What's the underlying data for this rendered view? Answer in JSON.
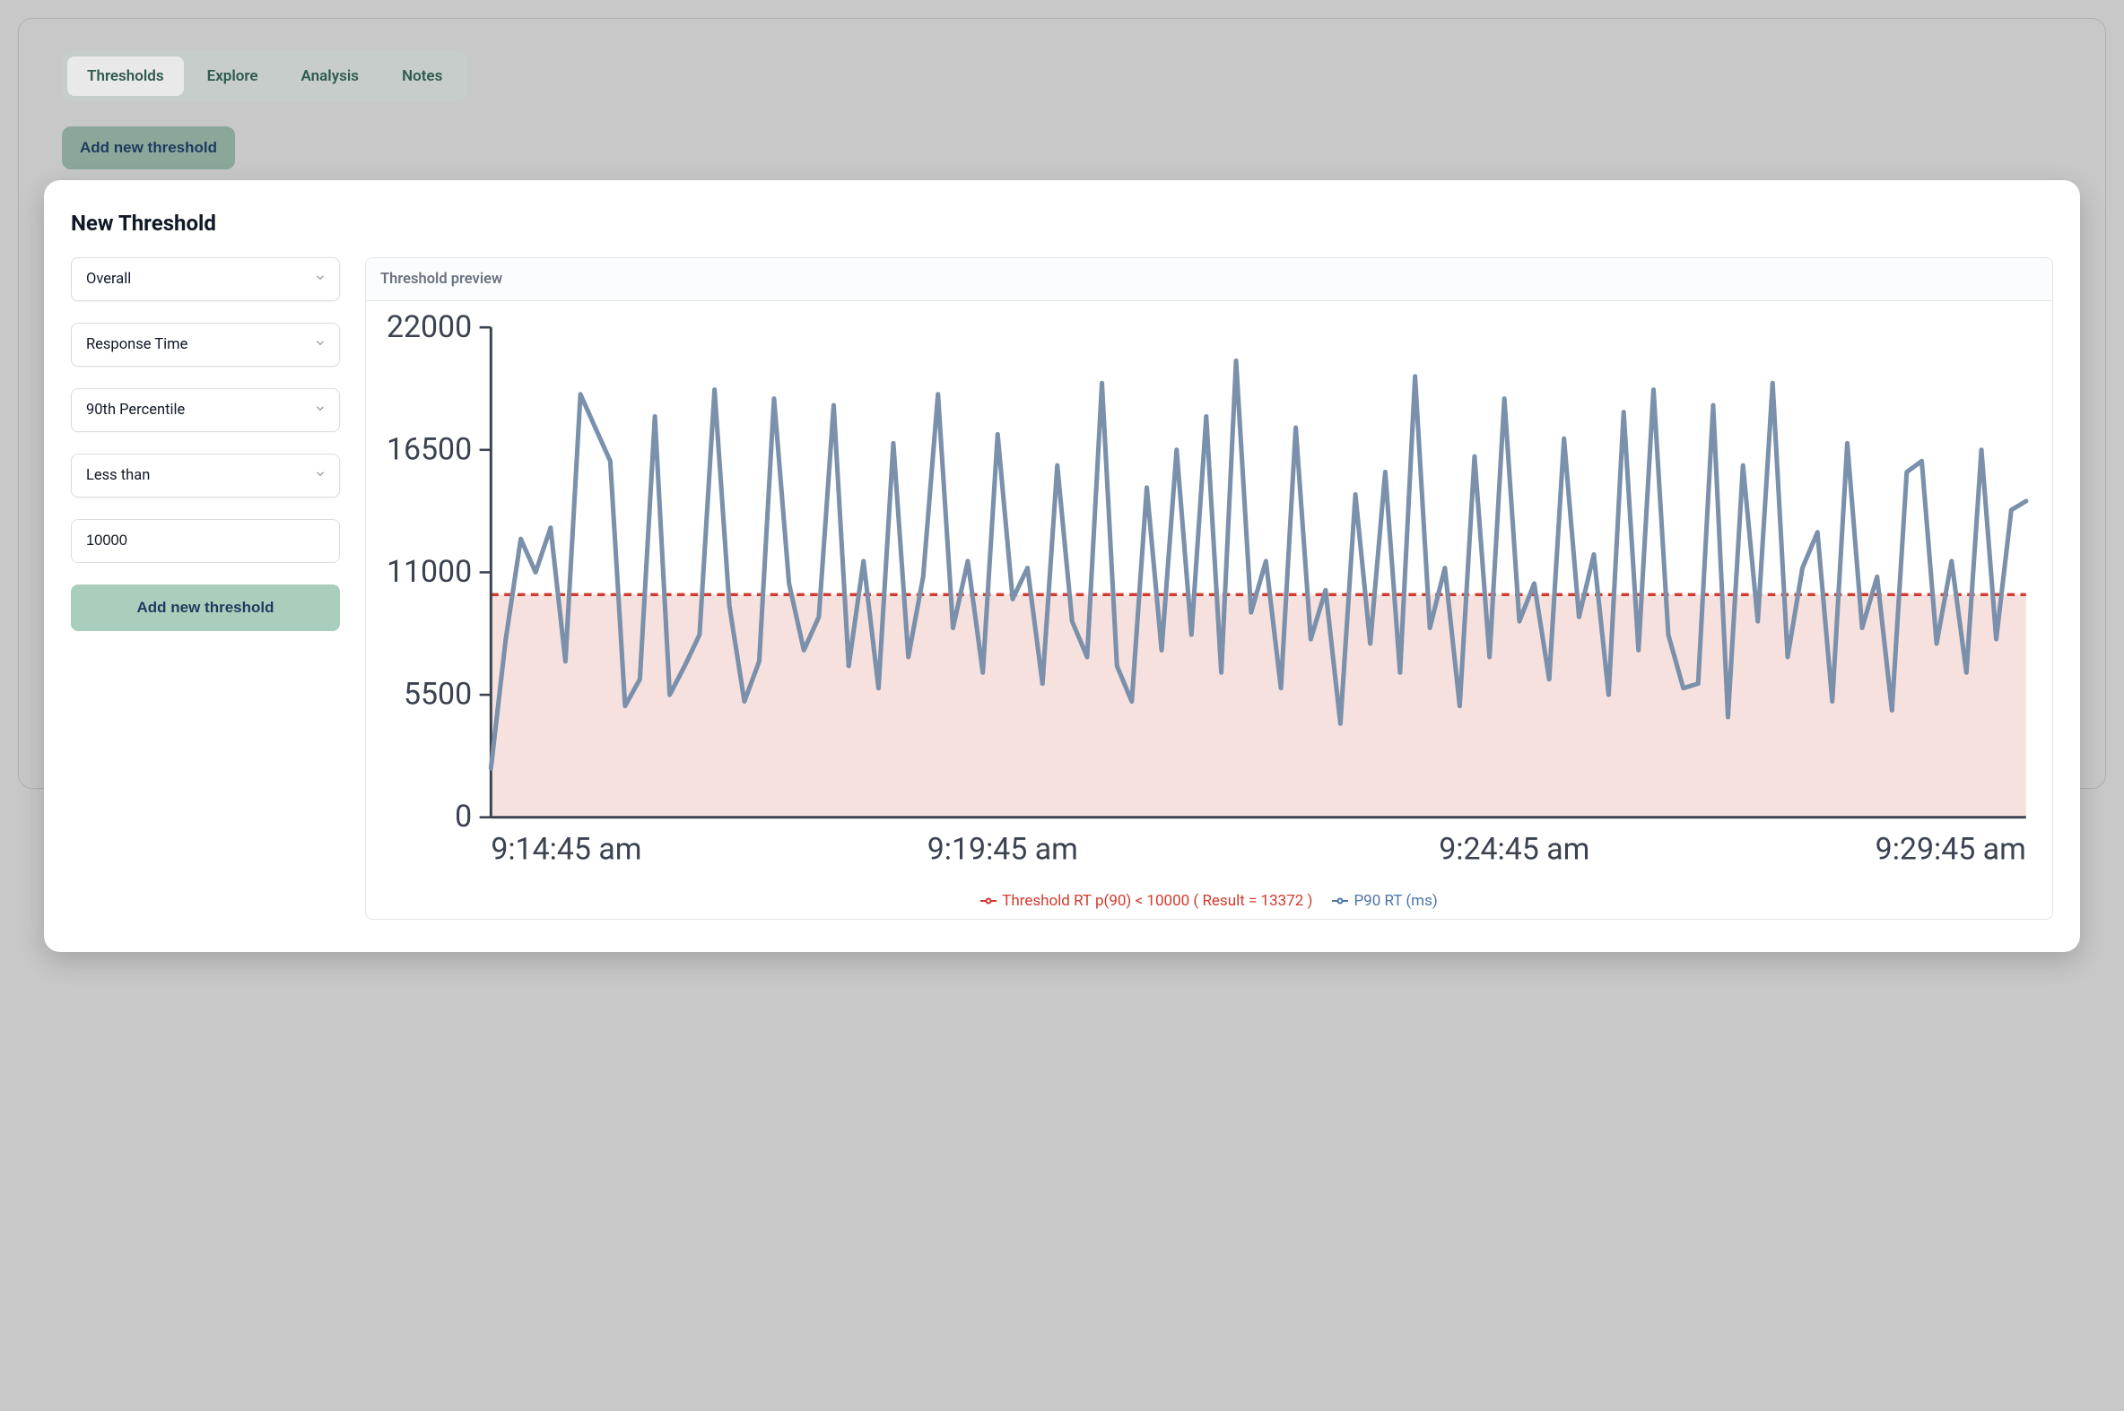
{
  "tabs": {
    "items": [
      "Thresholds",
      "Explore",
      "Analysis",
      "Notes"
    ],
    "active_index": 0
  },
  "top_button_label": "Add new threshold",
  "modal": {
    "title": "New Threshold",
    "scope_select": "Overall",
    "metric_select": "Response Time",
    "aggregation_select": "90th Percentile",
    "comparator_select": "Less than",
    "value_input": "10000",
    "submit_label": "Add new threshold"
  },
  "preview": {
    "header": "Threshold preview",
    "legend_threshold": "Threshold RT p(90) < 10000 ( Result = 13372 )",
    "legend_series": "P90 RT (ms)"
  },
  "chart_data": {
    "type": "line",
    "title": "",
    "xlabel": "",
    "ylabel": "",
    "ylim": [
      0,
      22000
    ],
    "y_ticks": [
      0,
      5500,
      11000,
      16500,
      22000
    ],
    "x_ticks": [
      "9:14:45 am",
      "9:19:45 am",
      "9:24:45 am",
      "9:29:45 am"
    ],
    "threshold": 10000,
    "series": [
      {
        "name": "P90 RT (ms)",
        "color": "#7a90ab",
        "values": [
          2200,
          8000,
          12500,
          11000,
          13000,
          7000,
          19000,
          17500,
          16000,
          5000,
          6200,
          18000,
          5500,
          6800,
          8200,
          19200,
          9500,
          5200,
          7000,
          18800,
          10500,
          7500,
          9000,
          18500,
          6800,
          11500,
          5800,
          16800,
          7200,
          10800,
          19000,
          8500,
          11500,
          6500,
          17200,
          9800,
          11200,
          6000,
          15800,
          8800,
          7200,
          19500,
          6800,
          5200,
          14800,
          7500,
          16500,
          8200,
          18000,
          6500,
          20500,
          9200,
          11500,
          5800,
          17500,
          8000,
          10200,
          4200,
          14500,
          7800,
          15500,
          6500,
          19800,
          8500,
          11200,
          5000,
          16200,
          7200,
          18800,
          8800,
          10500,
          6200,
          17000,
          9000,
          11800,
          5500,
          18200,
          7500,
          19200,
          8200,
          5800,
          6000,
          18500,
          4500,
          15800,
          8800,
          19500,
          7200,
          11200,
          12800,
          5200,
          16800,
          8500,
          10800,
          4800,
          15500,
          16000,
          7800,
          11500,
          6500,
          16500,
          8000,
          13800,
          14200
        ]
      }
    ]
  }
}
